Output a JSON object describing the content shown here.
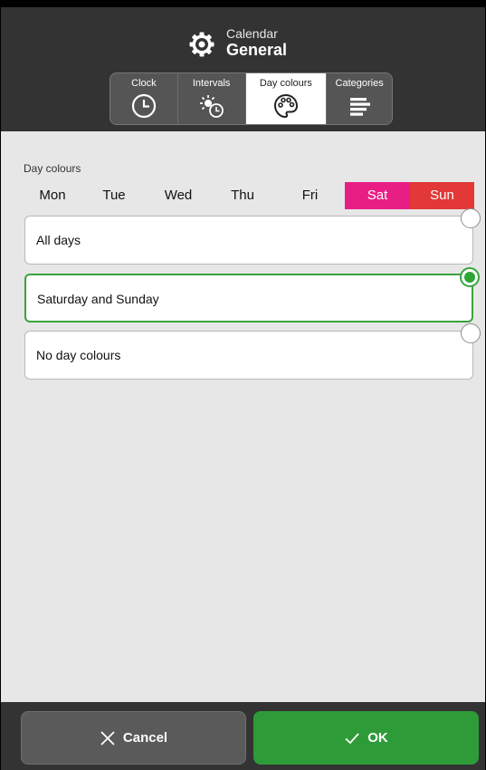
{
  "header": {
    "subtitle": "Calendar",
    "title": "General",
    "icon": "gear-icon"
  },
  "tabs": [
    {
      "label": "Clock",
      "icon": "clock-icon",
      "active": false
    },
    {
      "label": "Intervals",
      "icon": "sun-clock-icon",
      "active": false
    },
    {
      "label": "Day colours",
      "icon": "palette-icon",
      "active": true
    },
    {
      "label": "Categories",
      "icon": "categories-icon",
      "active": false
    }
  ],
  "day_colours": {
    "section_label": "Day colours",
    "days": [
      "Mon",
      "Tue",
      "Wed",
      "Thu",
      "Fri",
      "Sat",
      "Sun"
    ],
    "colors": {
      "sat": "#e91e84",
      "sun": "#e23838",
      "accent": "#2e9b39"
    }
  },
  "options": [
    {
      "label": "All days",
      "selected": false
    },
    {
      "label": "Saturday and Sunday",
      "selected": true
    },
    {
      "label": "No day colours",
      "selected": false
    }
  ],
  "footer": {
    "cancel_label": "Cancel",
    "ok_label": "OK"
  }
}
